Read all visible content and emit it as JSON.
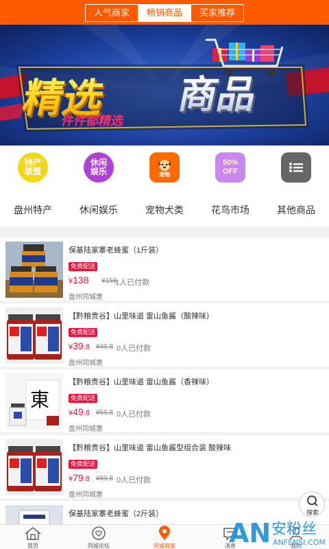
{
  "tabs": [
    {
      "label": "人气商家"
    },
    {
      "label": "畅销商品"
    },
    {
      "label": "买家推荐"
    }
  ],
  "banner": {
    "headline": "精选商品",
    "tagline": "件件都精选"
  },
  "categories": [
    {
      "label": "盘州特产",
      "icon_text": "特产\n联盟",
      "icon": "specialty-icon",
      "color": "#f2d81a"
    },
    {
      "label": "休闲娱乐",
      "icon_text": "休闲\n娱乐",
      "icon": "leisure-icon",
      "color": "#b040d8"
    },
    {
      "label": "宠物犬类",
      "icon_text": "宠物",
      "icon": "pet-icon",
      "color": "#ff6a00"
    },
    {
      "label": "花鸟市场",
      "icon_text": "50%\nOFF",
      "icon": "discount-icon",
      "color": "#c988f0"
    },
    {
      "label": "其他商品",
      "icon_text": "",
      "icon": "list-icon",
      "color": "#666666"
    }
  ],
  "products": [
    {
      "title": "保基陆家寨老蜂蜜（1斤装）",
      "badge": "免费配送",
      "currency": "¥",
      "price": "138",
      "original": "¥158",
      "sold": "1人已付款",
      "shop": "盘州同城惠"
    },
    {
      "title": "【黔粮贵谷】山里味道 雷山鱼酱（酸辣味）",
      "badge": "免费配送",
      "currency": "¥",
      "price": "39",
      "price_dec": ".8",
      "original": "¥49.8",
      "sold": "0人已付款",
      "shop": "盘州同城惠"
    },
    {
      "title": "【黔粮贵谷】山里味道 雷山鱼酱（香辣味）",
      "badge": "免费配送",
      "currency": "¥",
      "price": "49",
      "price_dec": ".8",
      "original": "¥59.8",
      "sold": "0人已付款",
      "shop": "盘州同城惠"
    },
    {
      "title": "【黔粮贵谷】山里味道 雷山鱼酱型组合装 酸辣味",
      "badge": "免费配送",
      "currency": "¥",
      "price": "79",
      "price_dec": ".8",
      "original": "¥89.8",
      "sold": "0人已付款",
      "shop": "盘州同城惠"
    },
    {
      "title": "保基陆家寨老蜂蜜（2斤装）"
    }
  ],
  "search_fab": {
    "label": "搜索"
  },
  "nav": [
    {
      "label": "首页",
      "icon": "home-icon"
    },
    {
      "label": "同城论坛",
      "icon": "heart-chat-icon"
    },
    {
      "label": "同城商家",
      "icon": "location-icon"
    },
    {
      "label": "消息",
      "icon": "message-icon"
    },
    {
      "label": "我的",
      "icon": "user-icon"
    }
  ],
  "watermark": {
    "letters": "AN",
    "cn": "安粉丝",
    "url": "ANFENSI.COM"
  },
  "colors": {
    "accent": "#ff5a00",
    "price": "#e8143c"
  }
}
